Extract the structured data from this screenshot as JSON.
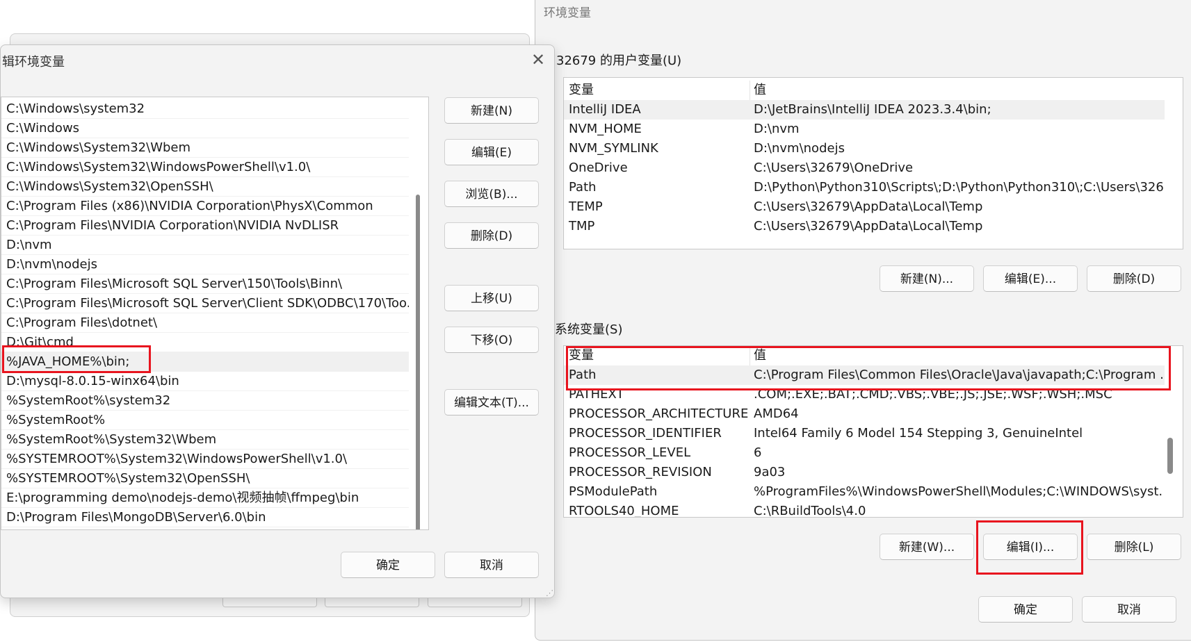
{
  "edit_dialog": {
    "title": "辑环境变量",
    "close_label": "✕",
    "paths": [
      "C:\\Windows\\system32",
      "C:\\Windows",
      "C:\\Windows\\System32\\Wbem",
      "C:\\Windows\\System32\\WindowsPowerShell\\v1.0\\",
      "C:\\Windows\\System32\\OpenSSH\\",
      "C:\\Program Files (x86)\\NVIDIA Corporation\\PhysX\\Common",
      "C:\\Program Files\\NVIDIA Corporation\\NVIDIA NvDLISR",
      "D:\\nvm",
      "D:\\nvm\\nodejs",
      "C:\\Program Files\\Microsoft SQL Server\\150\\Tools\\Binn\\",
      "C:\\Program Files\\Microsoft SQL Server\\Client SDK\\ODBC\\170\\Too...",
      "C:\\Program Files\\dotnet\\",
      "D:\\Git\\cmd",
      "%JAVA_HOME%\\bin;",
      "D:\\mysql-8.0.15-winx64\\bin",
      "%SystemRoot%\\system32",
      "%SystemRoot%",
      "%SystemRoot%\\System32\\Wbem",
      "%SYSTEMROOT%\\System32\\WindowsPowerShell\\v1.0\\",
      "%SYSTEMROOT%\\System32\\OpenSSH\\",
      "E:\\programming demo\\nodejs-demo\\视频抽帧\\ffmpeg\\bin",
      "D:\\Program Files\\MongoDB\\Server\\6.0\\bin"
    ],
    "selected_index": 13,
    "buttons": {
      "new": "新建(N)",
      "edit": "编辑(E)",
      "browse": "浏览(B)...",
      "delete": "删除(D)",
      "move_up": "上移(U)",
      "move_down": "下移(O)",
      "edit_text": "编辑文本(T)..."
    },
    "ok": "确定",
    "cancel": "取消"
  },
  "env_dialog": {
    "title": "环境变量",
    "user_section": "32679 的用户变量(U)",
    "system_section": "系统变量(S)",
    "header": {
      "name": "变量",
      "value": "值"
    },
    "user_vars": [
      {
        "name": "IntelliJ IDEA",
        "value": "D:\\JetBrains\\IntelliJ IDEA 2023.3.4\\bin;"
      },
      {
        "name": "NVM_HOME",
        "value": "D:\\nvm"
      },
      {
        "name": "NVM_SYMLINK",
        "value": "D:\\nvm\\nodejs"
      },
      {
        "name": "OneDrive",
        "value": "C:\\Users\\32679\\OneDrive"
      },
      {
        "name": "Path",
        "value": "D:\\Python\\Python310\\Scripts\\;D:\\Python\\Python310\\;C:\\Users\\326..."
      },
      {
        "name": "TEMP",
        "value": "C:\\Users\\32679\\AppData\\Local\\Temp"
      },
      {
        "name": "TMP",
        "value": "C:\\Users\\32679\\AppData\\Local\\Temp"
      }
    ],
    "system_vars": [
      {
        "name": "Path",
        "value": "C:\\Program Files\\Common Files\\Oracle\\Java\\javapath;C:\\Program ..."
      },
      {
        "name": "PATHEXT",
        "value": ".COM;.EXE;.BAT;.CMD;.VBS;.VBE;.JS;.JSE;.WSF;.WSH;.MSC"
      },
      {
        "name": "PROCESSOR_ARCHITECTURE",
        "value": "AMD64"
      },
      {
        "name": "PROCESSOR_IDENTIFIER",
        "value": "Intel64 Family 6 Model 154 Stepping 3, GenuineIntel"
      },
      {
        "name": "PROCESSOR_LEVEL",
        "value": "6"
      },
      {
        "name": "PROCESSOR_REVISION",
        "value": "9a03"
      },
      {
        "name": "PSModulePath",
        "value": "%ProgramFiles%\\WindowsPowerShell\\Modules;C:\\WINDOWS\\syst..."
      },
      {
        "name": "RTOOLS40_HOME",
        "value": "C:\\RBuildTools\\4.0"
      }
    ],
    "user_buttons": {
      "new": "新建(N)...",
      "edit": "编辑(E)...",
      "delete": "删除(D)"
    },
    "system_buttons": {
      "new": "新建(W)...",
      "edit": "编辑(I)...",
      "delete": "删除(L)"
    },
    "ok": "确定",
    "cancel": "取消"
  },
  "highlight_color": "#e8141e"
}
